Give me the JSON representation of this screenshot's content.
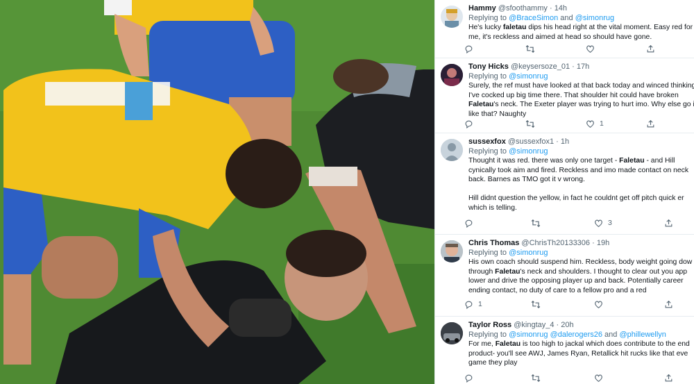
{
  "tweets": [
    {
      "name": "Hammy",
      "handle": "@sfoothammy",
      "time": "14h",
      "replying_prefix": "Replying to",
      "mentions": [
        "@BraceSimon",
        "@simonrug"
      ],
      "conjunction": "and",
      "body_lines": [
        [
          "He's lucky ",
          "*faletau",
          " dips his head right at the vital moment. Easy red for"
        ],
        [
          "me, it's reckless and aimed at head so should have gone."
        ]
      ],
      "actions": {
        "reply": "",
        "retweet": "",
        "like": ""
      }
    },
    {
      "name": "Tony Hicks",
      "handle": "@keysersoze_01",
      "time": "17h",
      "replying_prefix": "Replying to",
      "mentions": [
        "@simonrug"
      ],
      "body_lines": [
        [
          "Surely, the ref must have looked at that back today and winced thinking"
        ],
        [
          "I've cocked up big time there. That shoulder hit could have broken"
        ],
        [
          "*Faletau",
          "'s neck. The Exeter player was trying to hurt imo. Why else go in"
        ],
        [
          "like that? Naughty"
        ]
      ],
      "actions": {
        "reply": "",
        "retweet": "",
        "like": "1"
      }
    },
    {
      "name": "sussexfox",
      "handle": "@sussexfox1",
      "time": "1h",
      "replying_prefix": "Replying to",
      "mentions": [
        "@simonrug"
      ],
      "body_lines": [
        [
          "Thought it was red. there was only one target  - ",
          "*Faletau",
          " - and Hill"
        ],
        [
          "cynically took aim and fired. Reckless and imo made contact on neck"
        ],
        [
          "back. Barnes as TMO got it v wrong."
        ],
        [
          ""
        ],
        [
          "Hill didnt question the yellow, in fact he couldnt get off pitch quick er"
        ],
        [
          "which is telling."
        ]
      ],
      "actions": {
        "reply": "",
        "retweet": "",
        "like": "3"
      }
    },
    {
      "name": "Chris Thomas",
      "handle": "@ChrisTh20133306",
      "time": "19h",
      "replying_prefix": "Replying to",
      "mentions": [
        "@simonrug"
      ],
      "body_lines": [
        [
          "His own coach should suspend him. Reckless, body weight going dow"
        ],
        [
          "through ",
          "*Faletau",
          "'s neck and shoulders. I thought to clear out you app"
        ],
        [
          "lower and drive the opposing player up and back. Potentially career"
        ],
        [
          "ending contact, no duty of care to a fellow pro and a red"
        ]
      ],
      "actions": {
        "reply": "1",
        "retweet": "",
        "like": ""
      }
    },
    {
      "name": "Taylor Ross",
      "handle": "@kingtay_4",
      "time": "20h",
      "replying_prefix": "Replying to",
      "mentions": [
        "@simonrug",
        "@dalerogers26",
        "@phillewellyn"
      ],
      "conjunction": "and",
      "body_lines": [
        [
          "For me, ",
          "*Faletau",
          " is too high to jackal which does contribute to the end"
        ],
        [
          "product- you'll see AWJ, James Ryan, Retallick hit rucks like that eve"
        ],
        [
          "game they play"
        ]
      ],
      "actions": {
        "reply": "",
        "retweet": "",
        "like": ""
      }
    }
  ],
  "colors": {
    "link": "#1d9bf0",
    "muted": "#536471",
    "text": "#0f1419",
    "jersey_yellow": "#f2c21b",
    "jersey_blue": "#2d5fc4",
    "pitch_green": "#4f8a33"
  },
  "icons": [
    "reply-icon",
    "retweet-icon",
    "like-icon",
    "share-icon"
  ]
}
